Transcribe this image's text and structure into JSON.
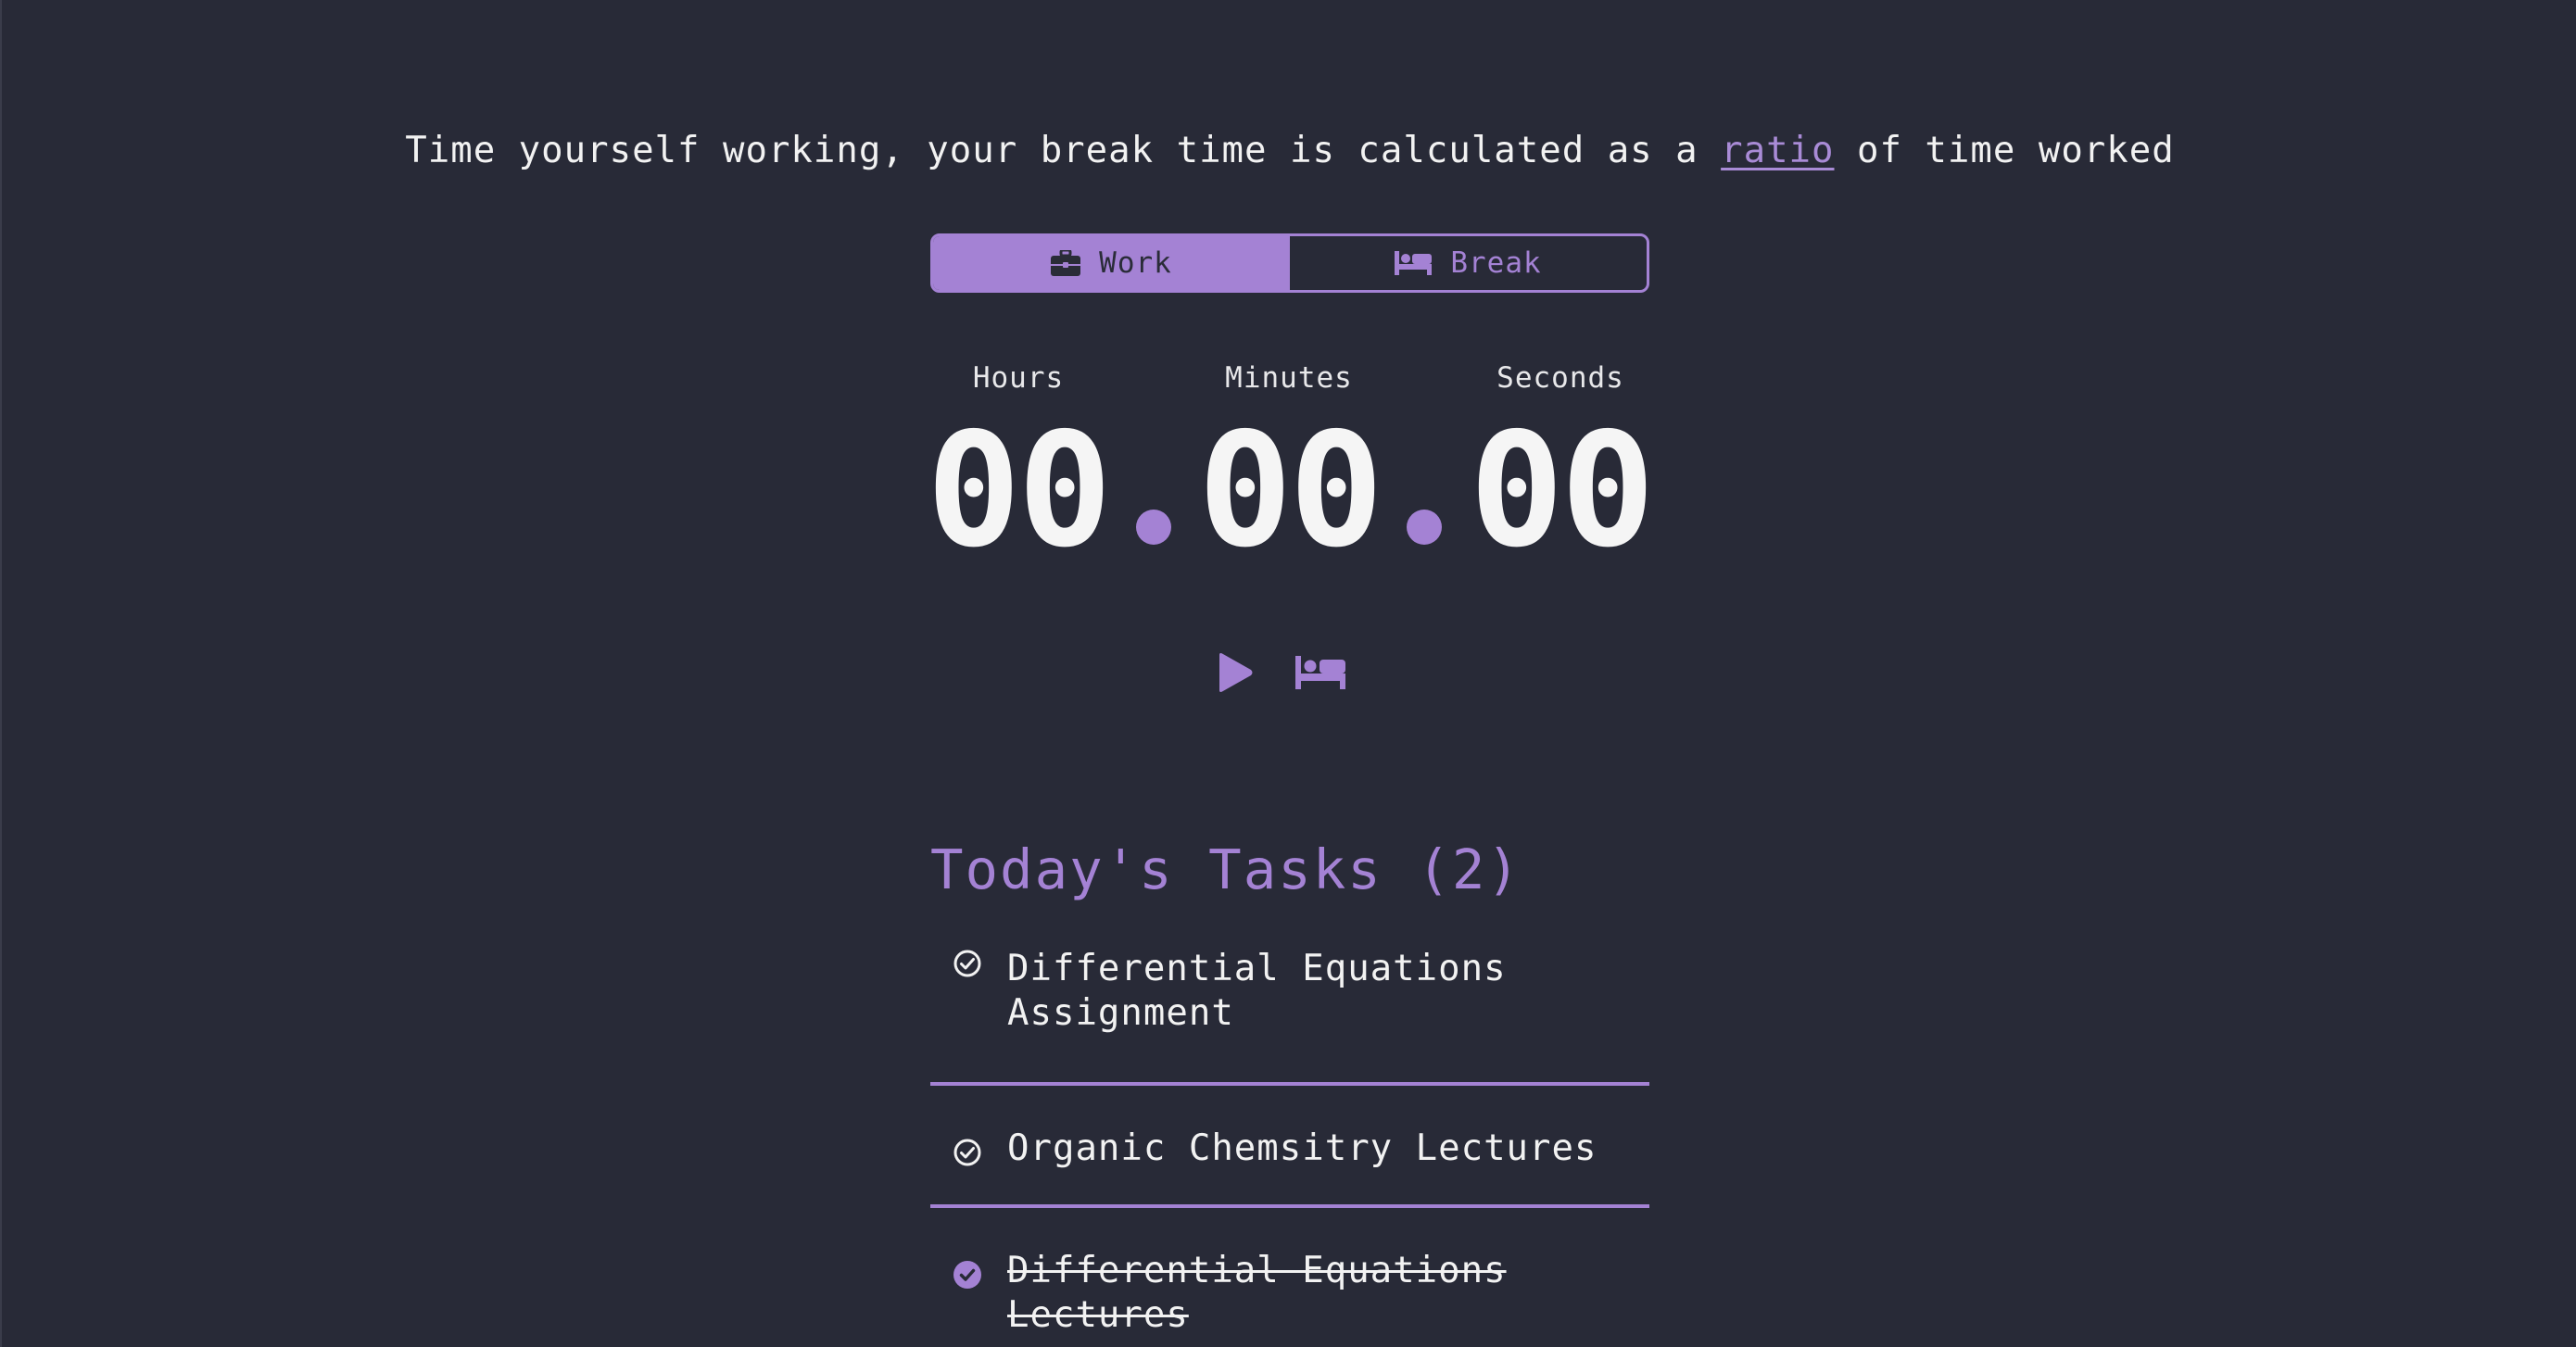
{
  "intro": {
    "before": "Time yourself working, your break time is calculated as a ",
    "link": "ratio",
    "after": " of time worked"
  },
  "mode_toggle": {
    "work_label": "Work",
    "break_label": "Break",
    "active": "Work"
  },
  "timer": {
    "hours_label": "Hours",
    "minutes_label": "Minutes",
    "seconds_label": "Seconds",
    "hours": "00",
    "minutes": "00",
    "seconds": "00"
  },
  "controls": {
    "play_icon": "play-icon",
    "break_icon": "bed-icon"
  },
  "tasks": {
    "title": "Today's Tasks (2)",
    "items": [
      {
        "text": "Differential Equations Assignment",
        "done": false
      },
      {
        "text": "Organic Chemsitry Lectures",
        "done": false
      },
      {
        "text": "Differential Equations Lectures",
        "done": true
      }
    ]
  },
  "colors": {
    "background": "#282a37",
    "accent": "#a482d4",
    "text": "#f2f2f2"
  }
}
